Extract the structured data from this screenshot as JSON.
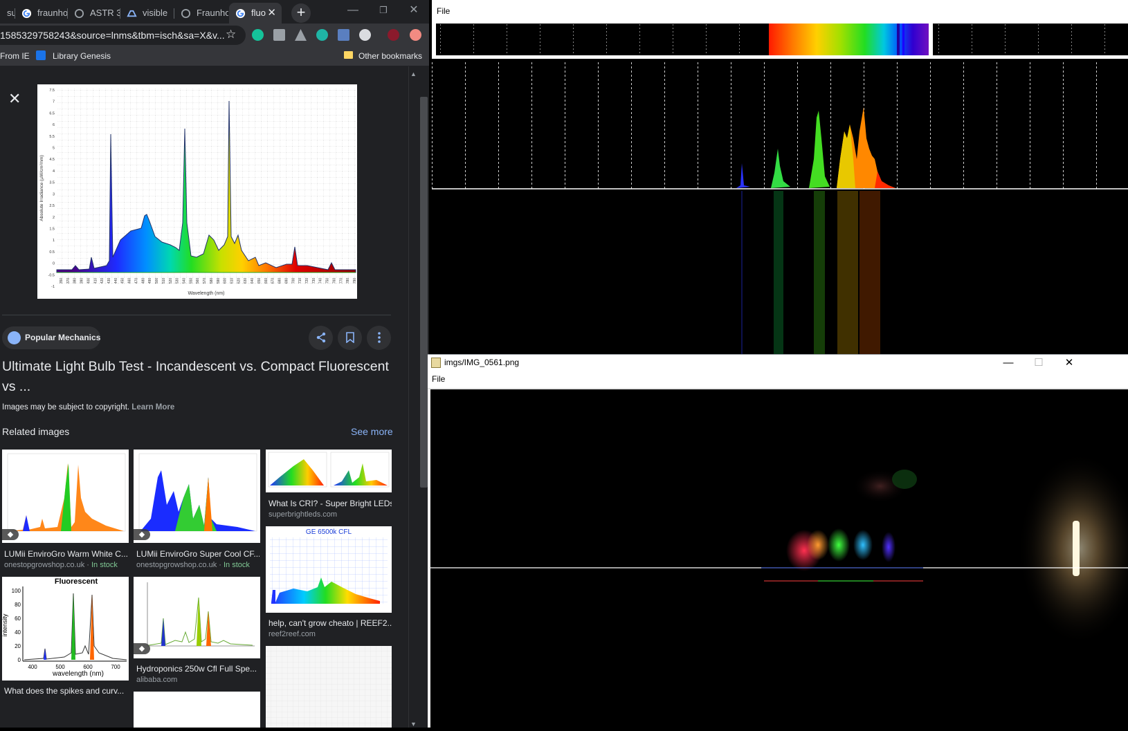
{
  "browser": {
    "tabs": [
      {
        "label": "sur",
        "favicon": "page-icon"
      },
      {
        "label": "fraunho",
        "favicon": "google-icon"
      },
      {
        "label": "ASTR 3",
        "favicon": "page-icon"
      },
      {
        "label": "visible",
        "favicon": "drive-icon"
      },
      {
        "label": "Fraunho",
        "favicon": "page-icon"
      },
      {
        "label": "fluo",
        "favicon": "google-icon",
        "active": true
      }
    ],
    "url": "1585329758243&source=lnms&tbm=isch&sa=X&v...",
    "bookmarks": {
      "from_ie": "From IE",
      "library_genesis": "Library Genesis",
      "other": "Other bookmarks"
    },
    "window_controls": {
      "minimize": "—",
      "restore": "❐",
      "close": "✕"
    }
  },
  "viewer": {
    "close_label": "✕",
    "main_chart": {
      "ylabel": "Absolute Irradiance (µW/cm²/nm)",
      "xlabel": "Wavelength (nm)",
      "yticks": [
        "7.5",
        "7",
        "6.5",
        "6",
        "5.5",
        "5",
        "4.5",
        "4",
        "3.5",
        "3",
        "2.5",
        "2",
        "1.5",
        "1",
        "0.5",
        "0",
        "-0.5",
        "-1"
      ],
      "xticks": [
        "350",
        "370",
        "380",
        "390",
        "400",
        "410",
        "420",
        "430",
        "440",
        "450",
        "460",
        "470",
        "480",
        "490",
        "500",
        "510",
        "520",
        "530",
        "540",
        "550",
        "560",
        "570",
        "580",
        "590",
        "600",
        "610",
        "620",
        "630",
        "640",
        "650",
        "660",
        "670",
        "680",
        "690",
        "700",
        "710",
        "720",
        "730",
        "740",
        "750",
        "760",
        "770",
        "780",
        "790"
      ]
    },
    "source": "Popular Mechanics",
    "title": "Ultimate Light Bulb Test - Incandescent vs. Compact Fluorescent vs ...",
    "copyright": "Images may be subject to copyright.",
    "learn_more": "Learn More",
    "related_header": "Related images",
    "see_more": "See more",
    "related": [
      {
        "caption": "LUMii EnviroGro Warm White C...",
        "domain": "onestopgrowshop.co.uk",
        "stock": "In stock"
      },
      {
        "caption": "LUMii EnviroGro Super Cool CF...",
        "domain": "onestopgrowshop.co.uk",
        "stock": "In stock"
      },
      {
        "caption": "What Is CRI? - Super Bright LEDs",
        "domain": "superbrightleds.com"
      },
      {
        "caption": "help, can't grow cheato | REEF2...",
        "domain": "reef2reef.com",
        "thumb_title": "GE 6500k CFL"
      },
      {
        "caption": "What does the spikes and curv...",
        "thumb_title": "Fluorescent",
        "thumb_xlabel": "wavelength (nm)",
        "thumb_ylabel": "intensity",
        "thumb_yticks": [
          "100",
          "80",
          "60",
          "40",
          "20",
          "0"
        ],
        "thumb_xticks": [
          "400",
          "500",
          "600",
          "700"
        ]
      },
      {
        "caption": "Hydroponics 250w Cfl Full Spe...",
        "domain": "alibaba.com"
      }
    ]
  },
  "spectrum_window": {
    "menu_file": "File"
  },
  "image_window": {
    "title": "imgs/IMG_0561.png",
    "menu_file": "File",
    "controls": {
      "minimize": "—",
      "maximize": "☐",
      "close": "✕"
    }
  }
}
